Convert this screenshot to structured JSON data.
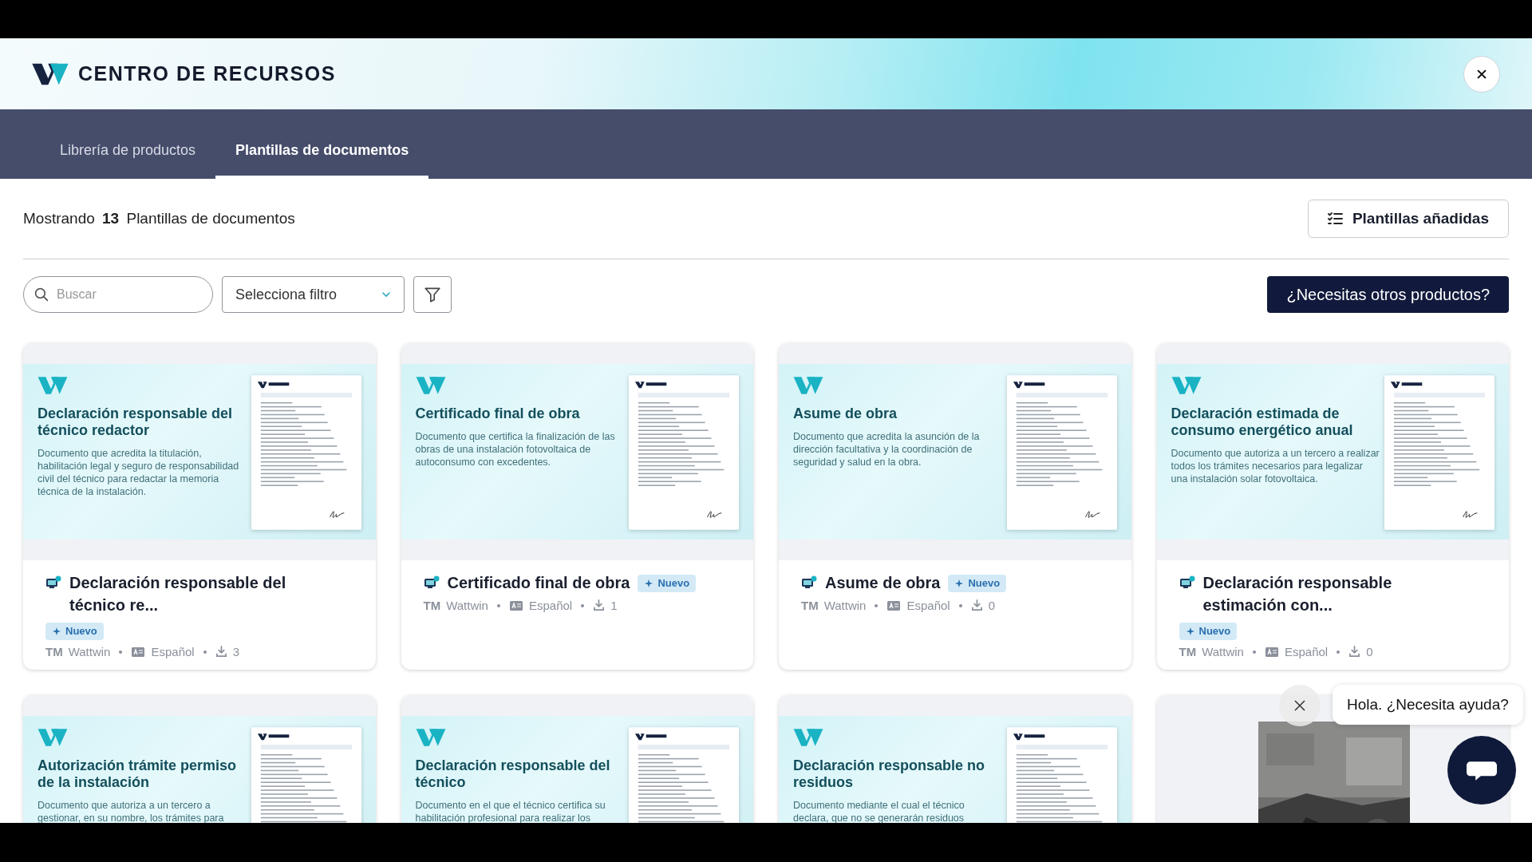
{
  "header": {
    "title": "CENTRO DE RECURSOS"
  },
  "tabs": [
    {
      "label": "Librería de productos",
      "selected": false
    },
    {
      "label": "Plantillas de documentos",
      "selected": true
    }
  ],
  "summary": {
    "prefix": "Mostrando",
    "count": "13",
    "suffix": "Plantillas de documentos"
  },
  "added_button": "Plantillas añadidas",
  "search": {
    "placeholder": "Buscar"
  },
  "filter_select": "Selecciona filtro",
  "cta_button": "¿Necesitas otros productos?",
  "cards": [
    {
      "kind": "template",
      "preview": {
        "title": "Declaración responsable del técnico redactor",
        "description": "Documento que acredita la titulación, habilitación legal y seguro de responsabilidad civil del técnico para redactar la memoria técnica de la instalación."
      },
      "title": "Declaración responsable del técnico re...",
      "badge": "Nuevo",
      "author_initials": "TM",
      "author": "Wattwin",
      "language": "Español",
      "downloads": "3"
    },
    {
      "kind": "template",
      "preview": {
        "title": "Certificado final de obra",
        "description": "Documento que certifica la finalización de las obras de una instalación fotovoltaica de autoconsumo con excedentes."
      },
      "title": "Certificado final de obra",
      "badge": "Nuevo",
      "author_initials": "TM",
      "author": "Wattwin",
      "language": "Español",
      "downloads": "1"
    },
    {
      "kind": "template",
      "preview": {
        "title": "Asume de obra",
        "description": "Documento que acredita la asunción de la dirección facultativa y la coordinación de seguridad y salud en la obra."
      },
      "title": "Asume de obra",
      "badge": "Nuevo",
      "author_initials": "TM",
      "author": "Wattwin",
      "language": "Español",
      "downloads": "0"
    },
    {
      "kind": "template",
      "preview": {
        "title": "Declaración estimada de consumo energético anual",
        "description": "Documento que autoriza a un tercero a realizar todos los trámites necesarios para legalizar una instalación solar fotovoltaica."
      },
      "title": "Declaración responsable estimación con...",
      "badge": "Nuevo",
      "author_initials": "TM",
      "author": "Wattwin",
      "language": "Español",
      "downloads": "0"
    },
    {
      "kind": "template",
      "preview": {
        "title": "Autorización trámite permiso de la instalación",
        "description": "Documento que autoriza a un tercero a gestionar, en su nombre, los trámites para"
      }
    },
    {
      "kind": "template",
      "preview": {
        "title": "Declaración responsable del técnico",
        "description": "Documento en el que el técnico certifica su habilitación profesional para realizar los"
      }
    },
    {
      "kind": "template",
      "preview": {
        "title": "Declaración responsable no residuos",
        "description": "Documento mediante el cual el técnico declara, que no se generarán residuos"
      }
    },
    {
      "kind": "picture"
    }
  ],
  "chat": {
    "message": "Hola. ¿Necesita ayuda?"
  }
}
